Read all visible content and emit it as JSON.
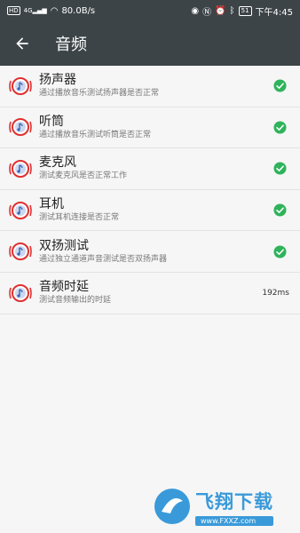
{
  "status_bar": {
    "hd": "HD",
    "signal": "4G",
    "speed": "80.0B/s",
    "battery": "51",
    "time": "下午4:45"
  },
  "app_bar": {
    "title": "音频"
  },
  "items": [
    {
      "title": "扬声器",
      "subtitle": "通过播放音乐测试扬声器是否正常",
      "status": "ok"
    },
    {
      "title": "听筒",
      "subtitle": "通过播放音乐测试听筒是否正常",
      "status": "ok"
    },
    {
      "title": "麦克风",
      "subtitle": "测试麦克风是否正常工作",
      "status": "ok"
    },
    {
      "title": "耳机",
      "subtitle": "测试耳机连接是否正常",
      "status": "ok"
    },
    {
      "title": "双扬测试",
      "subtitle": "通过独立通道声音测试是否双扬声器",
      "status": "ok"
    },
    {
      "title": "音频时延",
      "subtitle": "测试音频输出的时延",
      "value": "192ms"
    }
  ],
  "watermark": {
    "brand": "飞翔下载",
    "url": "www.FXXZ.com"
  },
  "colors": {
    "bar": "#3d4447",
    "check": "#2fb35b",
    "accent": "#e03030",
    "watermark": "#3a9ad9"
  }
}
